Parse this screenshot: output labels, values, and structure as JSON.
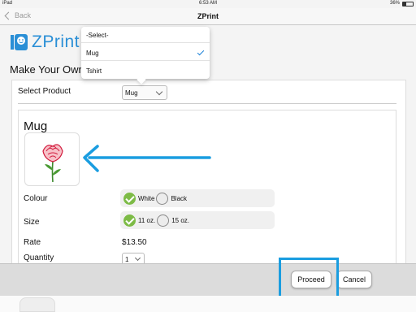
{
  "status_bar": {
    "device": "iPad",
    "time": "6:53 AM",
    "battery": "36%",
    "battery_level": 0.36
  },
  "nav": {
    "back_label": "Back",
    "title": "ZPrint"
  },
  "logo": {
    "text": "ZPrint"
  },
  "page": {
    "heading": "Make Your Own"
  },
  "product_select": {
    "label": "Select Product",
    "value": "Mug",
    "options": [
      {
        "label": "-Select-",
        "selected": false
      },
      {
        "label": "Mug",
        "selected": true
      },
      {
        "label": "Tshirt",
        "selected": false
      }
    ]
  },
  "product": {
    "title": "Mug",
    "image": "rose-flower-image",
    "colour": {
      "label": "Colour",
      "options": [
        {
          "label": "White",
          "selected": true
        },
        {
          "label": "Black",
          "selected": false
        }
      ]
    },
    "size": {
      "label": "Size",
      "options": [
        {
          "label": "11 oz.",
          "selected": true
        },
        {
          "label": "15 oz.",
          "selected": false
        }
      ]
    },
    "rate": {
      "label": "Rate",
      "value": "$13.50"
    },
    "quantity": {
      "label": "Quantity",
      "value": "1"
    }
  },
  "footer": {
    "proceed_label": "Proceed",
    "cancel_label": "Cancel"
  },
  "colors": {
    "accent": "#1a9de0",
    "logo": "#2a8fd6",
    "selected_radio": "#7dbb46"
  }
}
